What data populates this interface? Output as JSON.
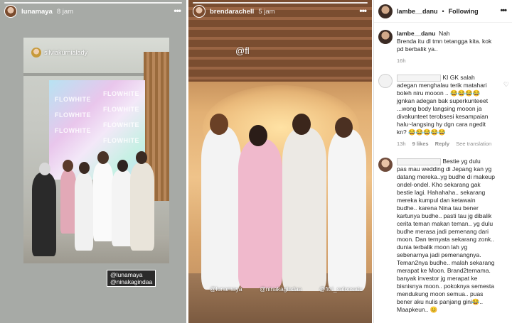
{
  "story1": {
    "username": "lunamaya",
    "time": "8 jam",
    "tagged_user": "silviakurnialady",
    "backdrop_text": [
      "FLOWHITE",
      "FLOWHITE",
      "FLOWHITE",
      "FLOWHITE",
      "FLOWHITE",
      "FLOWHITE",
      "FLOWHITE"
    ],
    "mentions": [
      "@lunamaya",
      "@ninakagindaa"
    ]
  },
  "story2": {
    "username": "brendarachell",
    "time": "5 jam",
    "sign_text": "@fl",
    "mentions": [
      "@lunamaya",
      "@ninakagindaa",
      "@fitri_salonsatu"
    ]
  },
  "panel": {
    "header": {
      "username": "lambe__danu",
      "dot": "•",
      "follow_label": "Following"
    },
    "caption": {
      "username": "lambe__danu",
      "lines": [
        "Nah",
        "Brenda itu dl tmn tetangga kita. kok",
        "pd berbalik ya.."
      ],
      "time": "16h"
    },
    "comments": [
      {
        "lines": [
          "KI GK salah",
          "adegan menghalau terik matahari",
          "boleh niru mooon .. 😂😂😂😂",
          "jgnkan adegan bak superkunteeet",
          "...wong body langsing mooon ja",
          "divakunteet terobsesi kesampaian",
          "halu~langsing hy dgn cara ngedit",
          "kn? 😂😂😂😂😂"
        ],
        "meta": {
          "time": "13h",
          "likes": "9 likes",
          "reply": "Reply",
          "translation": "See translation"
        }
      },
      {
        "lines": [
          "Bestie yg dulu",
          "pas mau wedding di Jepang kan yg",
          "datang mereka..yg budhe di makeup",
          "ondel-ondel. Kho sekarang gak",
          "bestie lagi. Hahahaha.. sekarang",
          "mereka kumpul dan ketawain",
          "budhe.. karena Nina tau bener",
          "kartunya budhe.. pasti tau jg dibalik",
          "cerita teman makan teman.. yg dulu",
          "budhe merasa jadi pemenang dari",
          "moon. Dan ternyata sekarang zonk..",
          "dunia terbalik moon lah yg",
          "sebenarnya jadi pemenangnya.",
          "Teman2nya budhe.. malah sekarang",
          "merapat ke Moon. Brand2ternama.",
          "banyak investor jg merapat ke",
          "bisnisnya moon.. pokoknya semesta",
          "mendukung moon semua.. puas",
          "bener aku nulis panjang gini😂..",
          "Maapkeun.. 😊"
        ]
      }
    ]
  }
}
